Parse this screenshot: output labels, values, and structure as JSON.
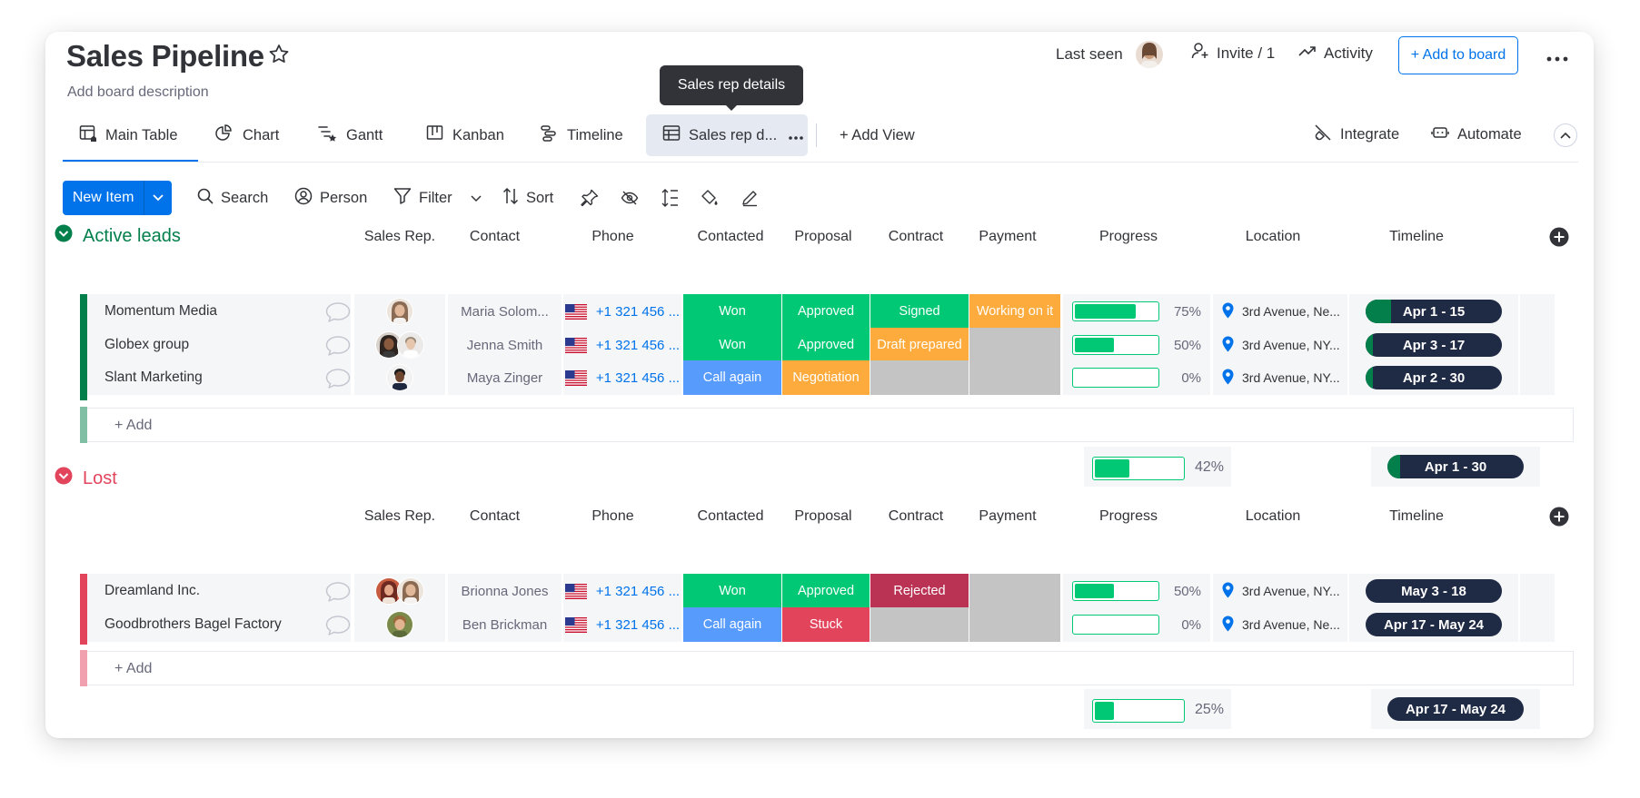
{
  "board": {
    "title": "Sales Pipeline",
    "description": "Add board description",
    "last_seen_label": "Last seen",
    "invite_label": "Invite / 1",
    "activity_label": "Activity",
    "add_to_board_label": "+ Add to board"
  },
  "tooltip": "Sales rep details",
  "views": {
    "tabs": [
      {
        "label": "Main Table",
        "icon": "table-home-icon"
      },
      {
        "label": "Chart",
        "icon": "chart-icon"
      },
      {
        "label": "Gantt",
        "icon": "gantt-icon"
      },
      {
        "label": "Kanban",
        "icon": "kanban-icon"
      },
      {
        "label": "Timeline",
        "icon": "timeline-icon"
      },
      {
        "label": "Sales rep d...",
        "icon": "table-icon"
      }
    ],
    "add_view_label": "+ Add View",
    "integrate_label": "Integrate",
    "automate_label": "Automate"
  },
  "toolbar": {
    "new_item_label": "New Item",
    "search_label": "Search",
    "person_label": "Person",
    "filter_label": "Filter",
    "sort_label": "Sort"
  },
  "columns": [
    "Sales Rep.",
    "Contact",
    "Phone",
    "Contacted",
    "Proposal",
    "Contract",
    "Payment",
    "Progress",
    "Location",
    "Timeline"
  ],
  "add_item_label": "+ Add",
  "colors": {
    "won": "#00c875",
    "approved": "#00c875",
    "signed": "#00c875",
    "working": "#fdab3d",
    "draft": "#fdab3d",
    "negotiation": "#fdab3d",
    "call_again": "#579bfc",
    "stuck": "#e2445c",
    "rejected": "#bb3354",
    "empty": "#c4c4c4",
    "active_group": "#037f4c",
    "lost_group": "#e2445c",
    "accent": "#0073ea"
  },
  "groups": {
    "active": {
      "title": "Active leads",
      "rows": [
        {
          "name": "Momentum Media",
          "contact": "Maria Solom...",
          "phone": "+1 321 456 ...",
          "contacted": "Won",
          "proposal": "Approved",
          "contract": "Signed",
          "payment": "Working on it",
          "progress": 75,
          "progress_label": "75%",
          "location": "3rd Avenue, Ne...",
          "timeline": "Apr 1 - 15"
        },
        {
          "name": "Globex group",
          "contact": "Jenna Smith",
          "phone": "+1 321 456 ...",
          "contacted": "Won",
          "proposal": "Approved",
          "contract": "Draft prepared",
          "payment": "",
          "progress": 50,
          "progress_label": "50%",
          "location": "3rd Avenue, NY...",
          "timeline": "Apr 3 - 17"
        },
        {
          "name": "Slant Marketing",
          "contact": "Maya Zinger",
          "phone": "+1 321 456 ...",
          "contacted": "Call again",
          "proposal": "Negotiation",
          "contract": "",
          "payment": "",
          "progress": 0,
          "progress_label": "0%",
          "location": "3rd Avenue, NY...",
          "timeline": "Apr 2 - 30"
        }
      ],
      "summary_progress": 42,
      "summary_progress_label": "42%",
      "summary_timeline": "Apr 1 - 30"
    },
    "lost": {
      "title": "Lost",
      "rows": [
        {
          "name": "Dreamland Inc.",
          "contact": "Brionna Jones",
          "phone": "+1 321 456 ...",
          "contacted": "Won",
          "proposal": "Approved",
          "contract": "Rejected",
          "payment": "",
          "progress": 50,
          "progress_label": "50%",
          "location": "3rd Avenue, NY...",
          "timeline": "May 3 - 18"
        },
        {
          "name": "Goodbrothers Bagel Factory",
          "contact": "Ben Brickman",
          "phone": "+1 321 456 ...",
          "contacted": "Call again",
          "proposal": "Stuck",
          "contract": "",
          "payment": "",
          "progress": 0,
          "progress_label": "0%",
          "location": "3rd Avenue, Ne...",
          "timeline": "Apr 17 - May 24"
        }
      ],
      "summary_progress": 25,
      "summary_progress_label": "25%",
      "summary_timeline": "Apr 17 - May 24"
    }
  }
}
